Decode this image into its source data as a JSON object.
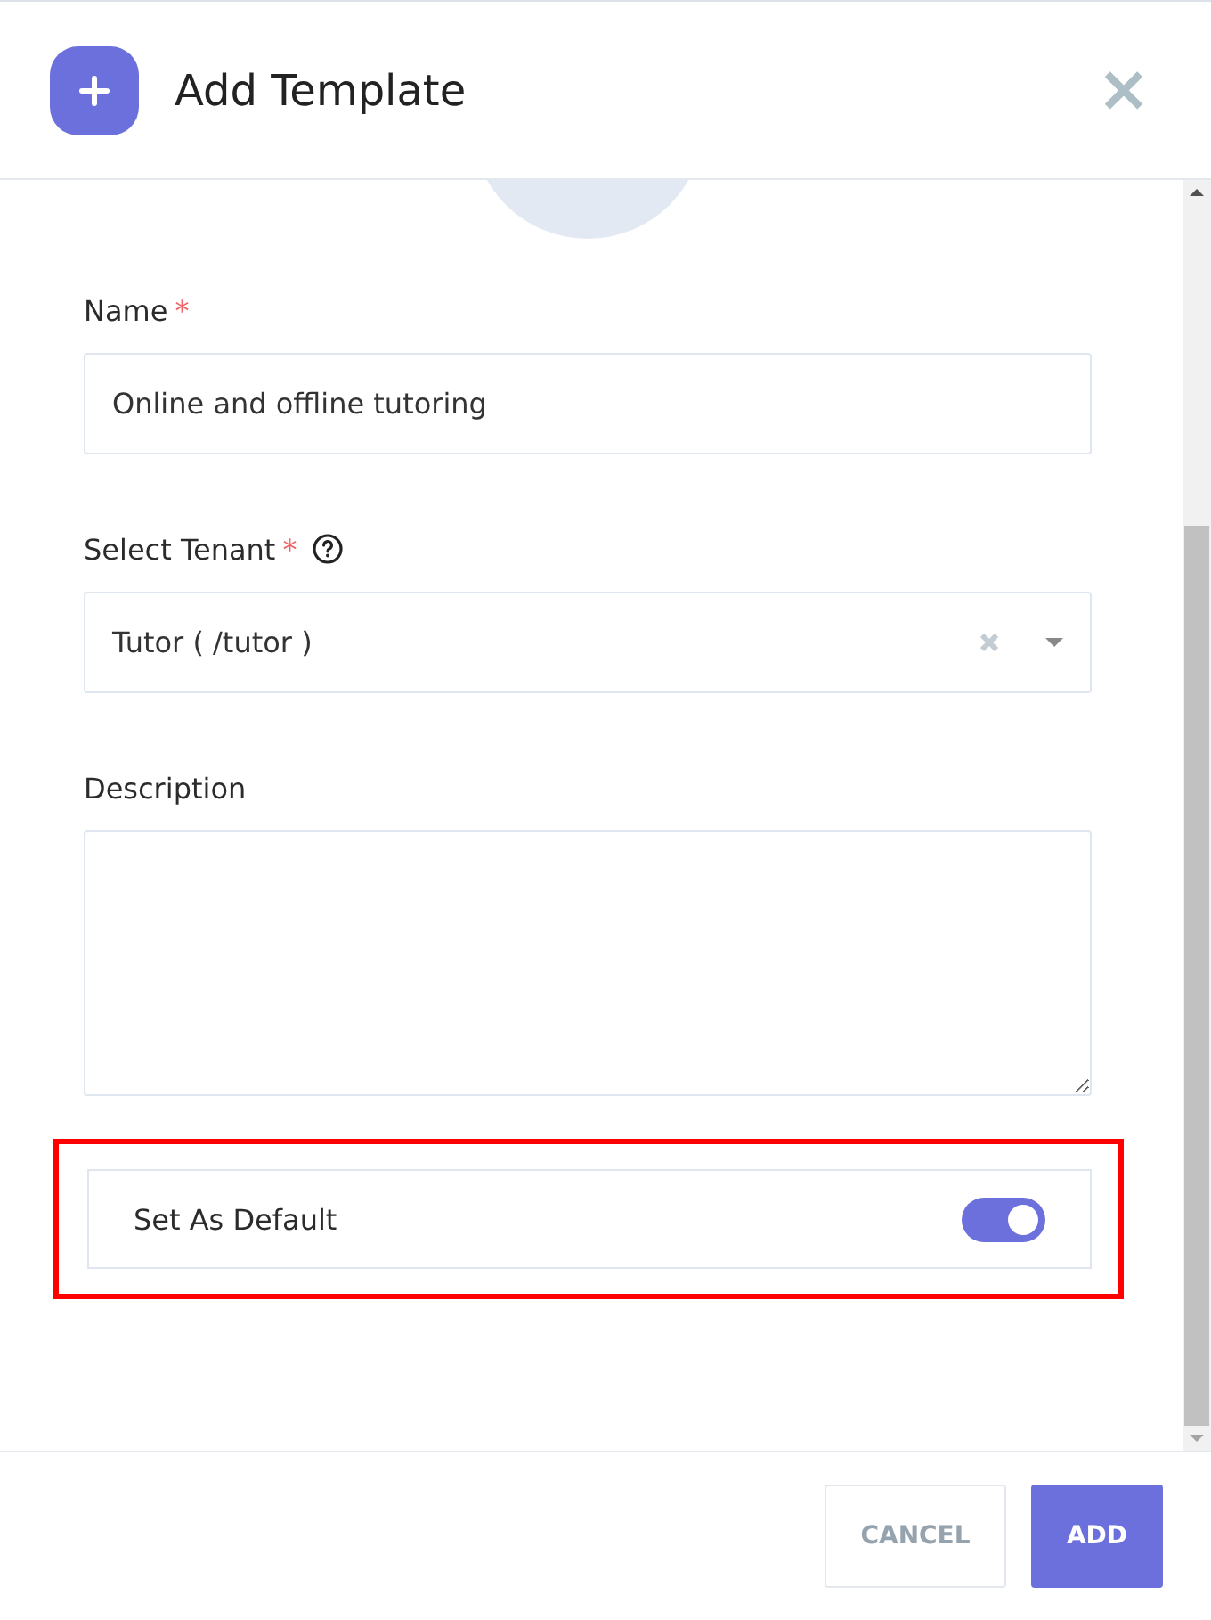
{
  "dialog": {
    "title": "Add Template",
    "close": "×"
  },
  "fields": [
    {
      "kind": "text",
      "label": "Name",
      "required_mark": "*",
      "help": false,
      "value": "Online and offline tutoring"
    },
    {
      "kind": "select",
      "label": "Select Tenant",
      "required_mark": "*",
      "help": true,
      "value": "Tutor ( /tutor )"
    },
    {
      "kind": "textarea",
      "label": "Description",
      "help": false
    }
  ],
  "default_toggle": {
    "label": "Set As Default",
    "on": true,
    "highlighted": true
  },
  "buttons": [
    {
      "label": "CANCEL",
      "kind": "secondary"
    },
    {
      "label": "ADD",
      "kind": "primary"
    }
  ]
}
